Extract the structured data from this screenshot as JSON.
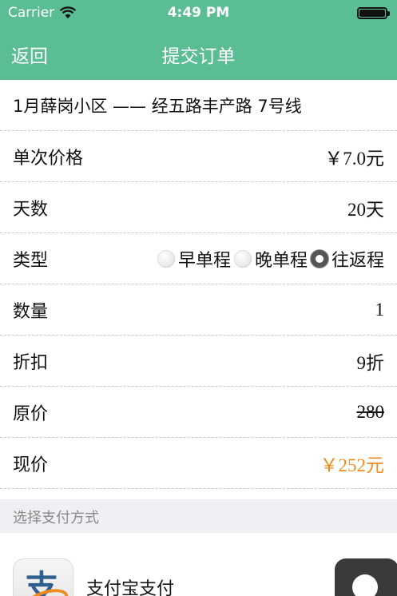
{
  "statusbar": {
    "carrier": "Carrier",
    "time": "4:49 PM"
  },
  "nav": {
    "back": "返回",
    "title": "提交订单"
  },
  "order": {
    "route": "1月薛岗小区 —— 经五路丰产路 7号线",
    "rows": {
      "unit_price": {
        "label": "单次价格",
        "value": "￥7.0元"
      },
      "days": {
        "label": "天数",
        "value": "20天"
      },
      "type": {
        "label": "类型",
        "options": [
          "早单程",
          "晚单程",
          "往返程"
        ],
        "selected": "往返程"
      },
      "quantity": {
        "label": "数量",
        "value": "1"
      },
      "discount": {
        "label": "折扣",
        "value": "9折"
      },
      "original_price": {
        "label": "原价",
        "value": "280"
      },
      "current_price": {
        "label": "现价",
        "value": "￥252元"
      }
    }
  },
  "payment": {
    "section_title": "选择支付方式",
    "alipay": {
      "logo_glyph": "支",
      "label": "支付宝支付"
    }
  },
  "colors": {
    "header": "#5bbd93",
    "price_accent": "#f08c1e"
  }
}
